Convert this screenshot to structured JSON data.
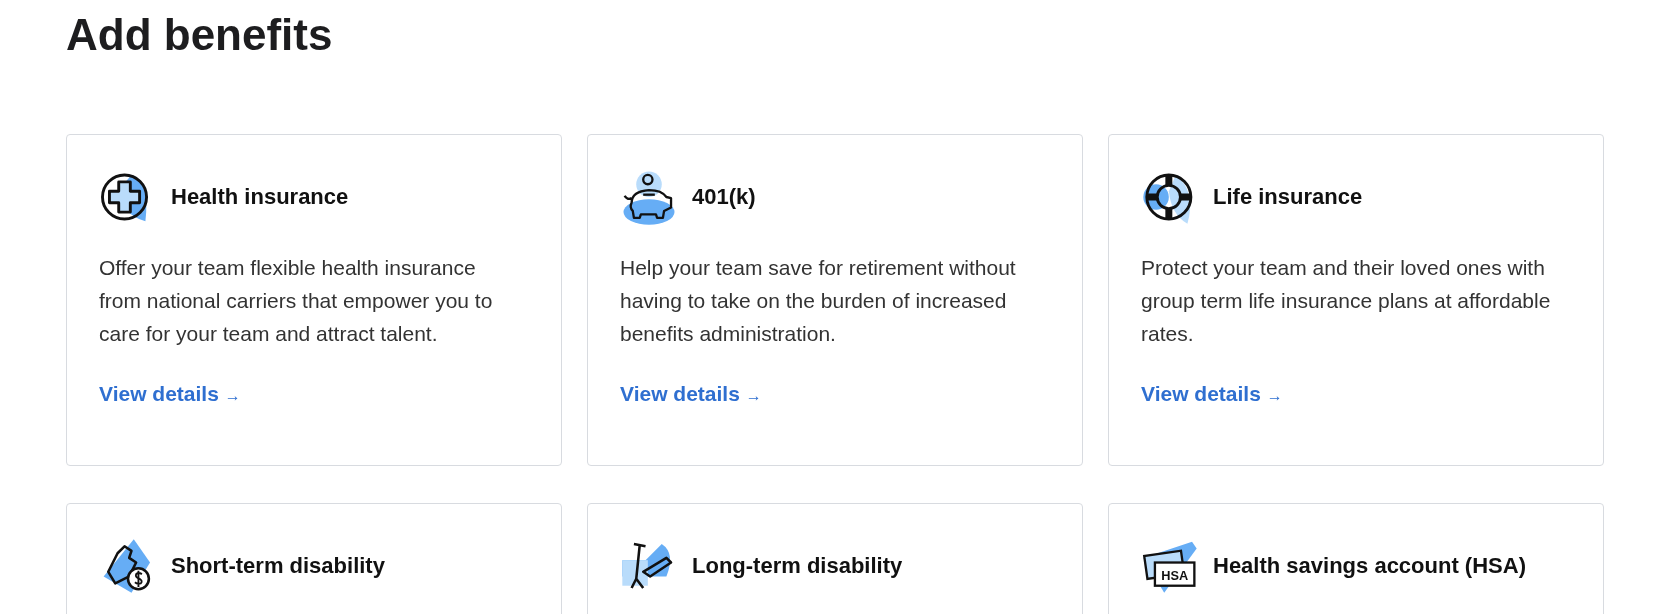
{
  "heading": "Add benefits",
  "cards": [
    {
      "title": "Health insurance",
      "description": "Offer your team flexible health insurance from national carriers that empower you to care for your team and attract talent.",
      "link": "View details",
      "link_arrow": "→"
    },
    {
      "title": "401(k)",
      "description": "Help your team save for retirement without having to take on the burden of increased benefits administration.",
      "link": "View details",
      "link_arrow": "→"
    },
    {
      "title": "Life insurance",
      "description": "Protect your team and their loved ones with group term life insurance plans at affordable rates.",
      "link": "View details",
      "link_arrow": "→"
    },
    {
      "title": "Short-term disability"
    },
    {
      "title": "Long-term disability"
    },
    {
      "title": "Health savings account (HSA)",
      "icon_text": "HSA"
    }
  ]
}
